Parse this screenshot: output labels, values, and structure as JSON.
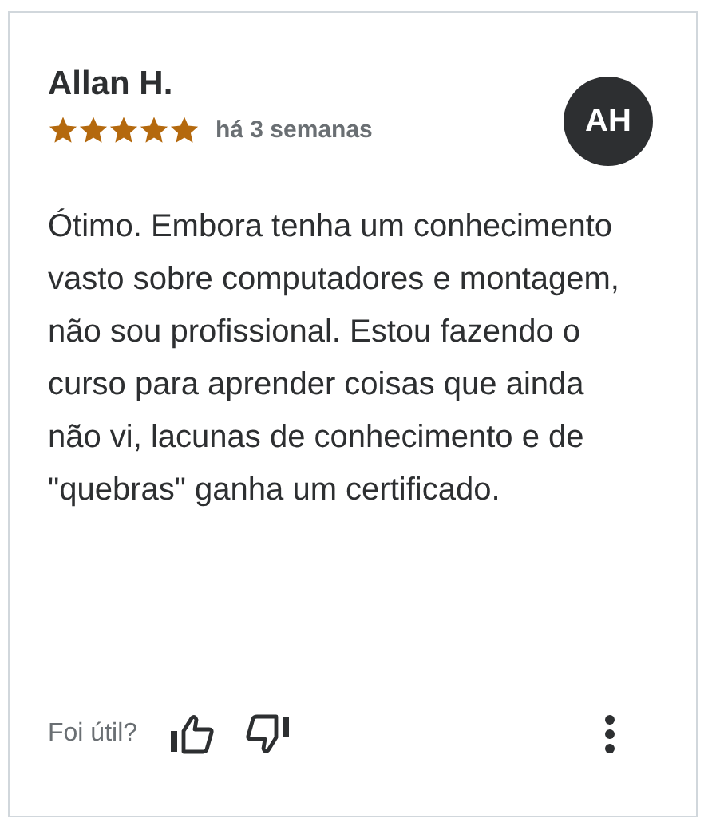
{
  "review": {
    "author": "Allan H.",
    "stars": 5,
    "time": "há 3 semanas",
    "avatar": "AH",
    "text": "Ótimo. Embora tenha um conhecimento vasto sobre computadores e montagem, não sou profissional. Estou fazendo o curso para aprender coisas que ainda não vi, lacunas de conhecimento e de \"quebras\" ganha um certificado."
  },
  "footer": {
    "helpful_label": "Foi útil?"
  }
}
